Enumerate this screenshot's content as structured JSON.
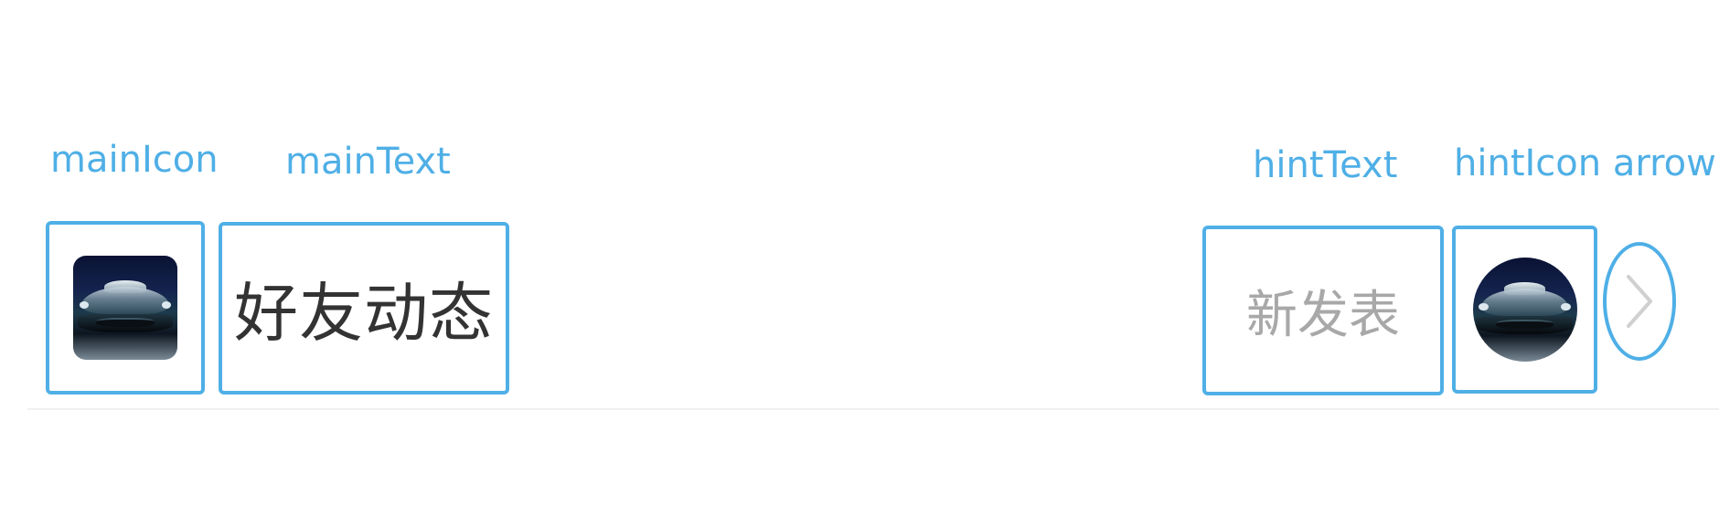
{
  "labels": {
    "main_icon": "mainIcon",
    "main_text": "mainText",
    "hint_text": "hintText",
    "hint_icon_arrow": "hintIcon arrow"
  },
  "cell": {
    "main_icon": "car-avatar",
    "main_text": "好友动态",
    "hint_text": "新发表",
    "hint_icon": "car-avatar",
    "arrow_icon": "chevron-right-icon"
  },
  "colors": {
    "annotation": "#4FAFE6",
    "main_text": "#333333",
    "hint_text": "#a8a8a8",
    "arrow": "#d0d0d0"
  }
}
